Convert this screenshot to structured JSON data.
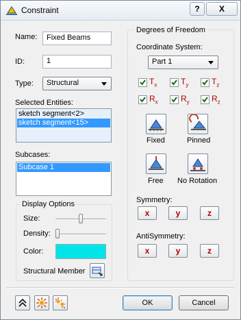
{
  "window": {
    "title": "Constraint",
    "help_glyph": "?",
    "close_glyph": "X"
  },
  "form": {
    "name_label": "Name:",
    "name_value": "Fixed Beams",
    "id_label": "ID:",
    "id_value": "1",
    "type_label": "Type:",
    "type_value": "Structural",
    "selected_entities_label": "Selected Entities:",
    "selected_entities": [
      {
        "text": "sketch segment<2>",
        "selected": false
      },
      {
        "text": "sketch segment<15>",
        "selected": true
      }
    ],
    "subcases_label": "Subcases:",
    "subcases": [
      {
        "text": "Subcase 1",
        "selected": true
      }
    ]
  },
  "display_options": {
    "title": "Display Options",
    "size_label": "Size:",
    "size_level": 0.52,
    "density_label": "Density:",
    "density_level": 0.0,
    "color_label": "Color:",
    "color": "#00e5e8",
    "structural_member_label": "Structural Member"
  },
  "dof": {
    "title": "Degrees of Freedom",
    "coord_label": "Coordinate System:",
    "coord_value": "Part 1",
    "checks": [
      {
        "letter": "T",
        "sub": "x",
        "checked": true
      },
      {
        "letter": "T",
        "sub": "y",
        "checked": true
      },
      {
        "letter": "T",
        "sub": "z",
        "checked": true
      },
      {
        "letter": "R",
        "sub": "x",
        "checked": true
      },
      {
        "letter": "R",
        "sub": "y",
        "checked": true
      },
      {
        "letter": "R",
        "sub": "z",
        "checked": true
      }
    ],
    "presets": [
      "Fixed",
      "Pinned",
      "Free",
      "No Rotation"
    ],
    "symmetry_label": "Symmetry:",
    "antisymmetry_label": "AntiSymmetry:",
    "axes": [
      "x",
      "y",
      "z"
    ]
  },
  "footer": {
    "ok_label": "OK",
    "cancel_label": "Cancel"
  },
  "colors": {
    "accent": "#3399ff",
    "dof_red": "#b00000",
    "swatch": "#00e5e8"
  }
}
